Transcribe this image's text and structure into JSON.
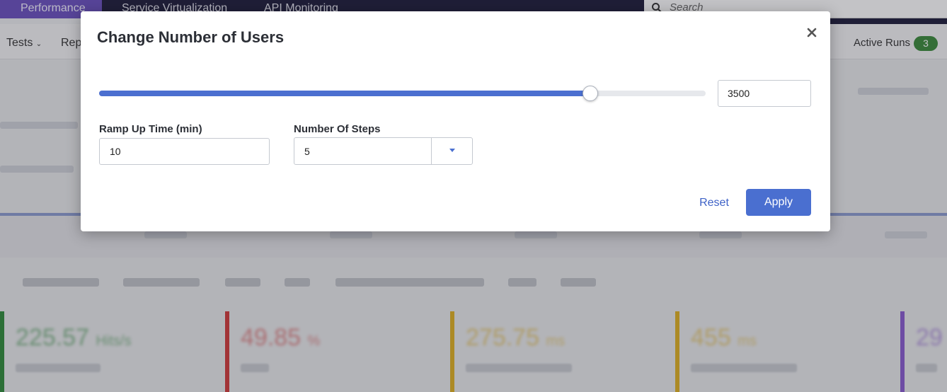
{
  "topnav": {
    "tabs": [
      {
        "label": "Performance",
        "active": true
      },
      {
        "label": "Service Virtualization",
        "active": false
      },
      {
        "label": "API Monitoring",
        "active": false
      }
    ],
    "search_placeholder": "Search"
  },
  "subbar": {
    "tests_label": "Tests",
    "reports_label": "Rep",
    "active_runs_label": "Active Runs",
    "active_runs_count": "3"
  },
  "modal": {
    "title": "Change Number of Users",
    "users_value": "3500",
    "users_slider_fraction": 0.81,
    "ramp_label": "Ramp Up Time (min)",
    "ramp_value": "10",
    "steps_label": "Number Of Steps",
    "steps_value": "5",
    "reset_label": "Reset",
    "apply_label": "Apply"
  },
  "background": {
    "kpis": [
      {
        "value": "225.57",
        "unit": "Hits/s",
        "color": "#2e8b3a"
      },
      {
        "value": "49.85",
        "unit": "%",
        "color": "#d23a3a"
      },
      {
        "value": "275.75",
        "unit": "ms",
        "color": "#e0b020"
      },
      {
        "value": "455",
        "unit": "ms",
        "color": "#e0b020"
      },
      {
        "value": "29",
        "unit": "",
        "color": "#8a5ad0"
      }
    ]
  },
  "colors": {
    "accent": "#4a6fd0",
    "nav_bg": "#1d1b3a",
    "nav_active": "#6a4fc0",
    "badge": "#3a8a3a"
  }
}
